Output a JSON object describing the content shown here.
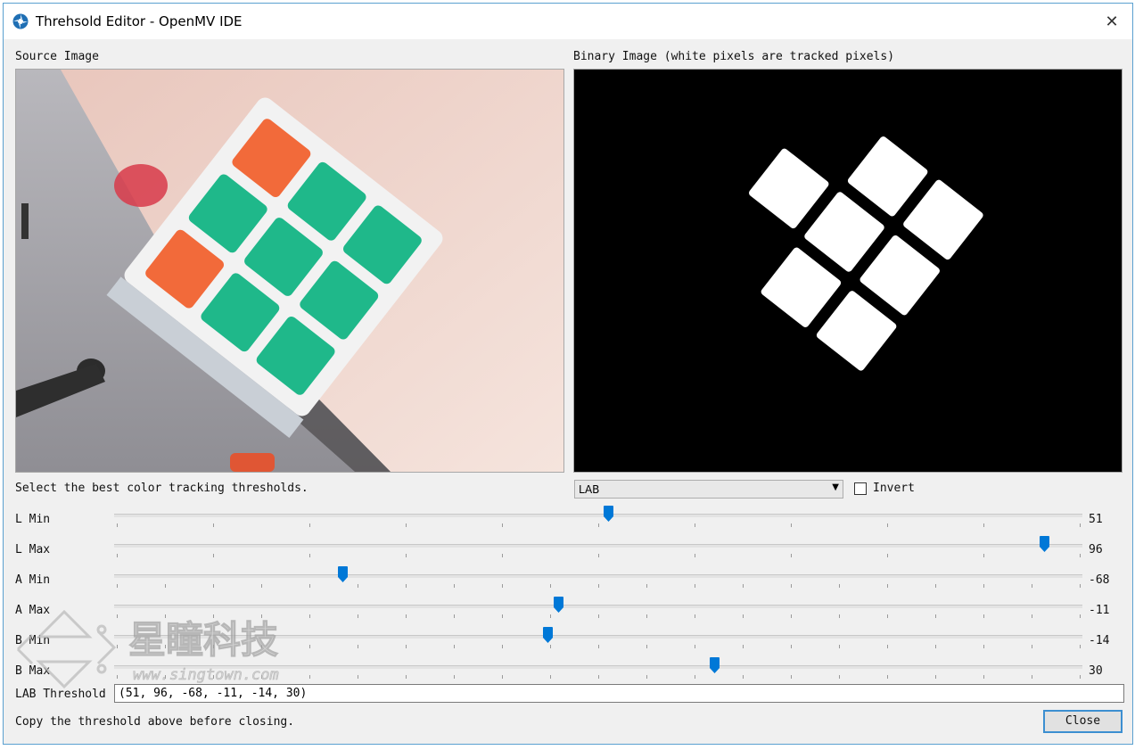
{
  "window": {
    "title": "Threhsold Editor - OpenMV IDE"
  },
  "source": {
    "label": "Source Image"
  },
  "binary": {
    "label": "Binary Image (white pixels are tracked pixels)"
  },
  "controls": {
    "instruction": "Select the best color tracking thresholds.",
    "color_space": "LAB",
    "invert_label": "Invert",
    "invert_checked": false
  },
  "sliders": [
    {
      "label": "L Min",
      "value": "51",
      "min": 0,
      "max": 100,
      "v": 51
    },
    {
      "label": "L Max",
      "value": "96",
      "min": 0,
      "max": 100,
      "v": 96
    },
    {
      "label": "A Min",
      "value": "-68",
      "min": -128,
      "max": 127,
      "v": -68
    },
    {
      "label": "A Max",
      "value": "-11",
      "min": -128,
      "max": 127,
      "v": -11
    },
    {
      "label": "B Min",
      "value": "-14",
      "min": -128,
      "max": 127,
      "v": -14
    },
    {
      "label": "B Max",
      "value": "30",
      "min": -128,
      "max": 127,
      "v": 30
    }
  ],
  "threshold": {
    "label": "LAB Threshold",
    "value": "(51, 96, -68, -11, -14, 30)"
  },
  "footer": {
    "note": "Copy the threshold above before closing.",
    "close_label": "Close"
  },
  "watermark": {
    "name": "星瞳科技",
    "url": "www.singtown.com"
  },
  "colors": {
    "accent": "#0078d7",
    "cube_green": "#1fb88a",
    "cube_orange": "#f26a3a"
  }
}
